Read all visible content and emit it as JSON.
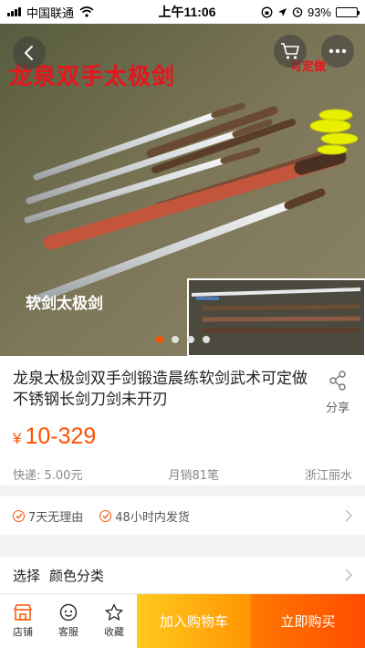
{
  "status_bar": {
    "carrier": "中国联通",
    "time": "上午11:06",
    "battery_percent": "93%",
    "battery_level": 0.93
  },
  "hero": {
    "overlay_title": "龙泉双手太极剑",
    "overlay_tag": "可定做",
    "overlay_caption": "软剑太极剑",
    "image_count": 4,
    "active_index": 0
  },
  "product": {
    "title": "龙泉太极剑双手剑锻造晨练软剑武术可定做不锈钢长剑刀剑未开刃",
    "currency": "¥",
    "price": "10-329",
    "share_label": "分享",
    "shipping": "快递: 5.00元",
    "monthly_sales": "月销81笔",
    "location": "浙江丽水"
  },
  "services": {
    "items": [
      "7天无理由",
      "48小时内发货"
    ]
  },
  "select": {
    "label": "选择",
    "value": "颜色分类"
  },
  "bottom_bar": {
    "tabs": [
      {
        "label": "店铺",
        "icon": "store-icon"
      },
      {
        "label": "客服",
        "icon": "chat-icon"
      },
      {
        "label": "收藏",
        "icon": "star-icon"
      }
    ],
    "add_to_cart": "加入购物车",
    "buy_now": "立即购买"
  },
  "colors": {
    "accent": "#ff5000",
    "cart_button": "#ff9402",
    "buy_button": "#ff4c00"
  }
}
